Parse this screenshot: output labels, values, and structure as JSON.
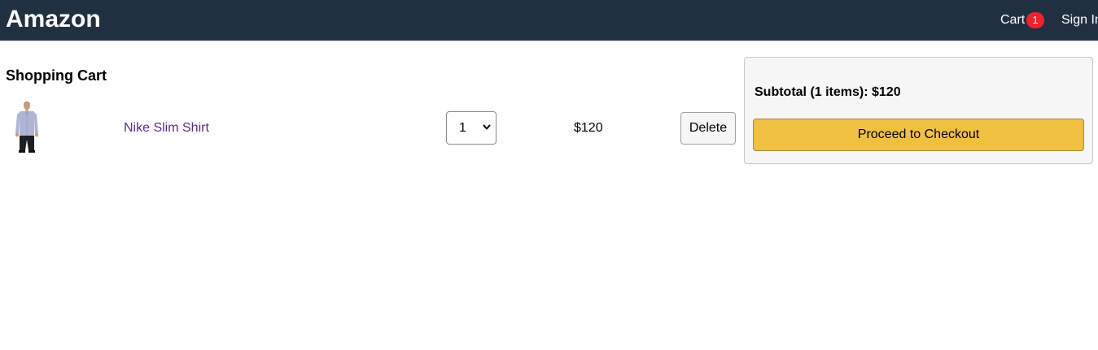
{
  "header": {
    "brand": "Amazon",
    "cart_label": "Cart",
    "cart_count": "1",
    "signin_label": "Sign In"
  },
  "cart": {
    "title": "Shopping Cart",
    "items": [
      {
        "name": "Nike Slim Shirt",
        "quantity": "1",
        "price": "$120",
        "delete_label": "Delete",
        "image_icon": "shirt-product-photo"
      }
    ]
  },
  "summary": {
    "subtotal_text": "Subtotal (1 items): $120",
    "checkout_label": "Proceed to Checkout"
  },
  "colors": {
    "header_bg": "#203040",
    "badge": "#f0212c",
    "checkout_button": "#f0c040",
    "link": "#5b2a86"
  }
}
